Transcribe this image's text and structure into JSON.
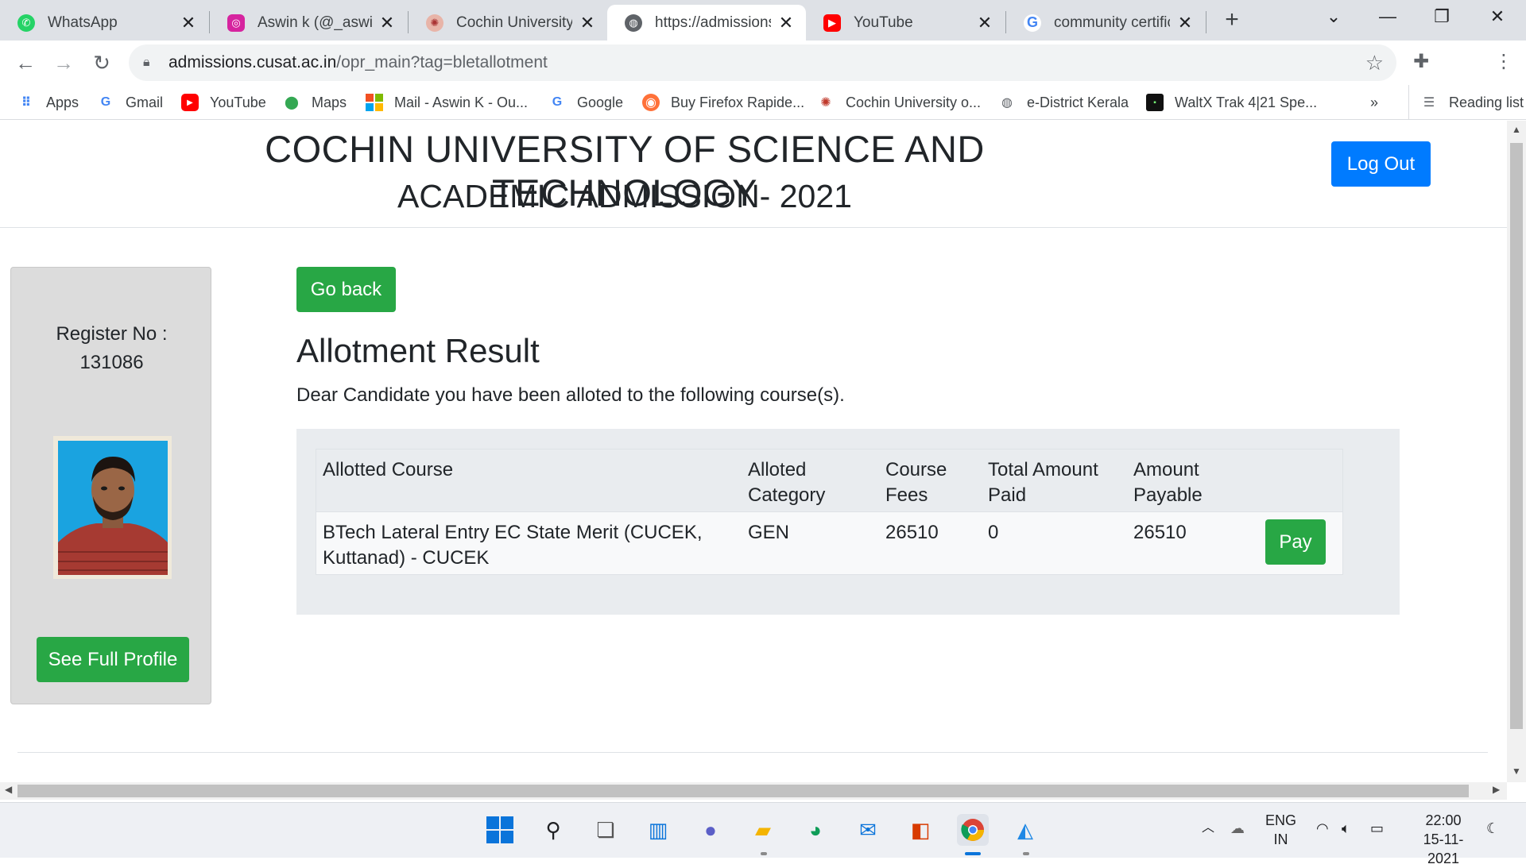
{
  "browser": {
    "tabs": [
      {
        "title": "WhatsApp",
        "icon": "whatsapp-icon",
        "active": false
      },
      {
        "title": "Aswin k (@_aswin_k",
        "icon": "instagram-icon",
        "active": false
      },
      {
        "title": "Cochin University o",
        "icon": "cusat-logo-icon",
        "active": false
      },
      {
        "title": "https://admissions.c",
        "icon": "globe-icon",
        "active": true
      },
      {
        "title": "YouTube",
        "icon": "youtube-icon",
        "active": false
      },
      {
        "title": "community certifica",
        "icon": "google-icon",
        "active": false
      }
    ],
    "url_host": "admissions.cusat.ac.in",
    "url_path": "/opr_main?tag=bletallotment",
    "bookmarks": [
      {
        "label": "Apps",
        "icon": "apps-grid-icon"
      },
      {
        "label": "Gmail",
        "icon": "google-icon"
      },
      {
        "label": "YouTube",
        "icon": "youtube-icon"
      },
      {
        "label": "Maps",
        "icon": "maps-pin-icon"
      },
      {
        "label": "Mail - Aswin K - Ou...",
        "icon": "microsoft-icon"
      },
      {
        "label": "Google",
        "icon": "google-icon"
      },
      {
        "label": "Buy Firefox Rapide...",
        "icon": "firefox-icon"
      },
      {
        "label": "Cochin University o...",
        "icon": "cusat-logo-icon"
      },
      {
        "label": "e-District Kerala",
        "icon": "globe-icon"
      },
      {
        "label": "WaltX Trak 4|21 Spe...",
        "icon": "waltx-icon"
      }
    ],
    "bookmarks_more": "»",
    "reading_list": "Reading list"
  },
  "page": {
    "university": "COCHIN UNIVERSITY OF SCIENCE AND TECHNOLOGY",
    "subtitle": "ACADEMIC ADMISSION- 2021",
    "logout_label": "Log Out",
    "register_label": "Register No :",
    "register_no": "131086",
    "full_profile_label": "See Full Profile",
    "go_back_label": "Go back",
    "result_title": "Allotment Result",
    "result_desc": "Dear Candidate you have been alloted to the following course(s).",
    "table": {
      "headers": {
        "course": "Allotted Course",
        "category": "Alloted Category",
        "fees": "Course Fees",
        "paid": "Total Amount Paid",
        "payable": "Amount Payable"
      },
      "row": {
        "course": "BTech Lateral Entry EC State Merit (CUCEK, Kuttanad) - CUCEK",
        "category": "GEN",
        "fees": "26510",
        "paid": "0",
        "payable": "26510",
        "pay_label": "Pay"
      }
    },
    "colors": {
      "primary": "#007bff",
      "success": "#28a745",
      "panel": "#e9ecef"
    }
  },
  "taskbar": {
    "lang_top": "ENG",
    "lang_bottom": "IN",
    "time": "22:00",
    "date": "15-11-2021"
  }
}
